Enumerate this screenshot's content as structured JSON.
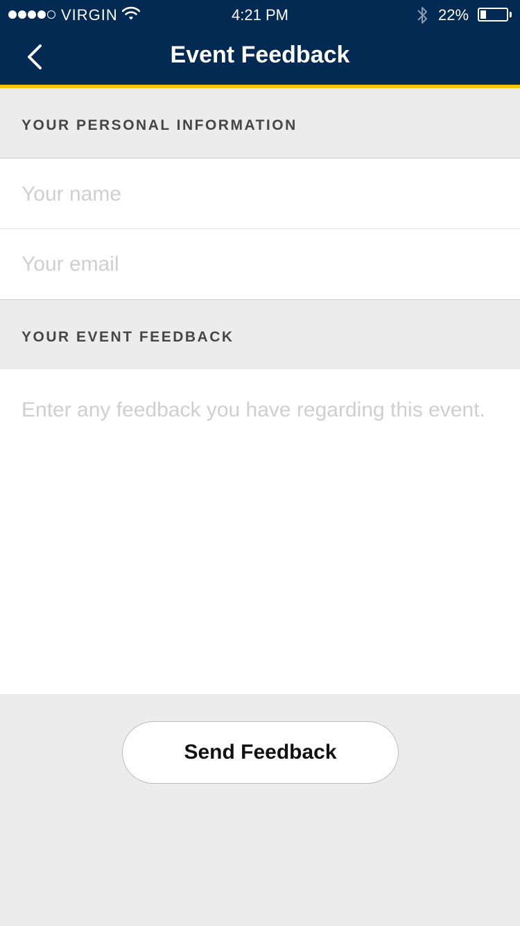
{
  "status_bar": {
    "carrier": "VIRGIN",
    "signal_bars_filled": 4,
    "signal_bars_total": 5,
    "time": "4:21 PM",
    "battery_percent": "22%",
    "battery_level": 0.22,
    "icons": [
      "signal-dots-icon",
      "wifi-icon",
      "bluetooth-icon",
      "battery-icon"
    ]
  },
  "nav": {
    "title": "Event Feedback",
    "back_icon": "chevron-left-icon"
  },
  "sections": {
    "personal": {
      "header": "YOUR PERSONAL INFORMATION",
      "name_placeholder": "Your name",
      "name_value": "",
      "email_placeholder": "Your email",
      "email_value": ""
    },
    "feedback": {
      "header": "YOUR EVENT FEEDBACK",
      "placeholder": "Enter any feedback you have regarding this event.",
      "value": ""
    }
  },
  "actions": {
    "send_label": "Send Feedback"
  },
  "colors": {
    "header_bg": "#032a52",
    "accent": "#f2c500",
    "page_bg": "#ececec",
    "placeholder": "#cfcfcf",
    "section_text": "#464646"
  }
}
